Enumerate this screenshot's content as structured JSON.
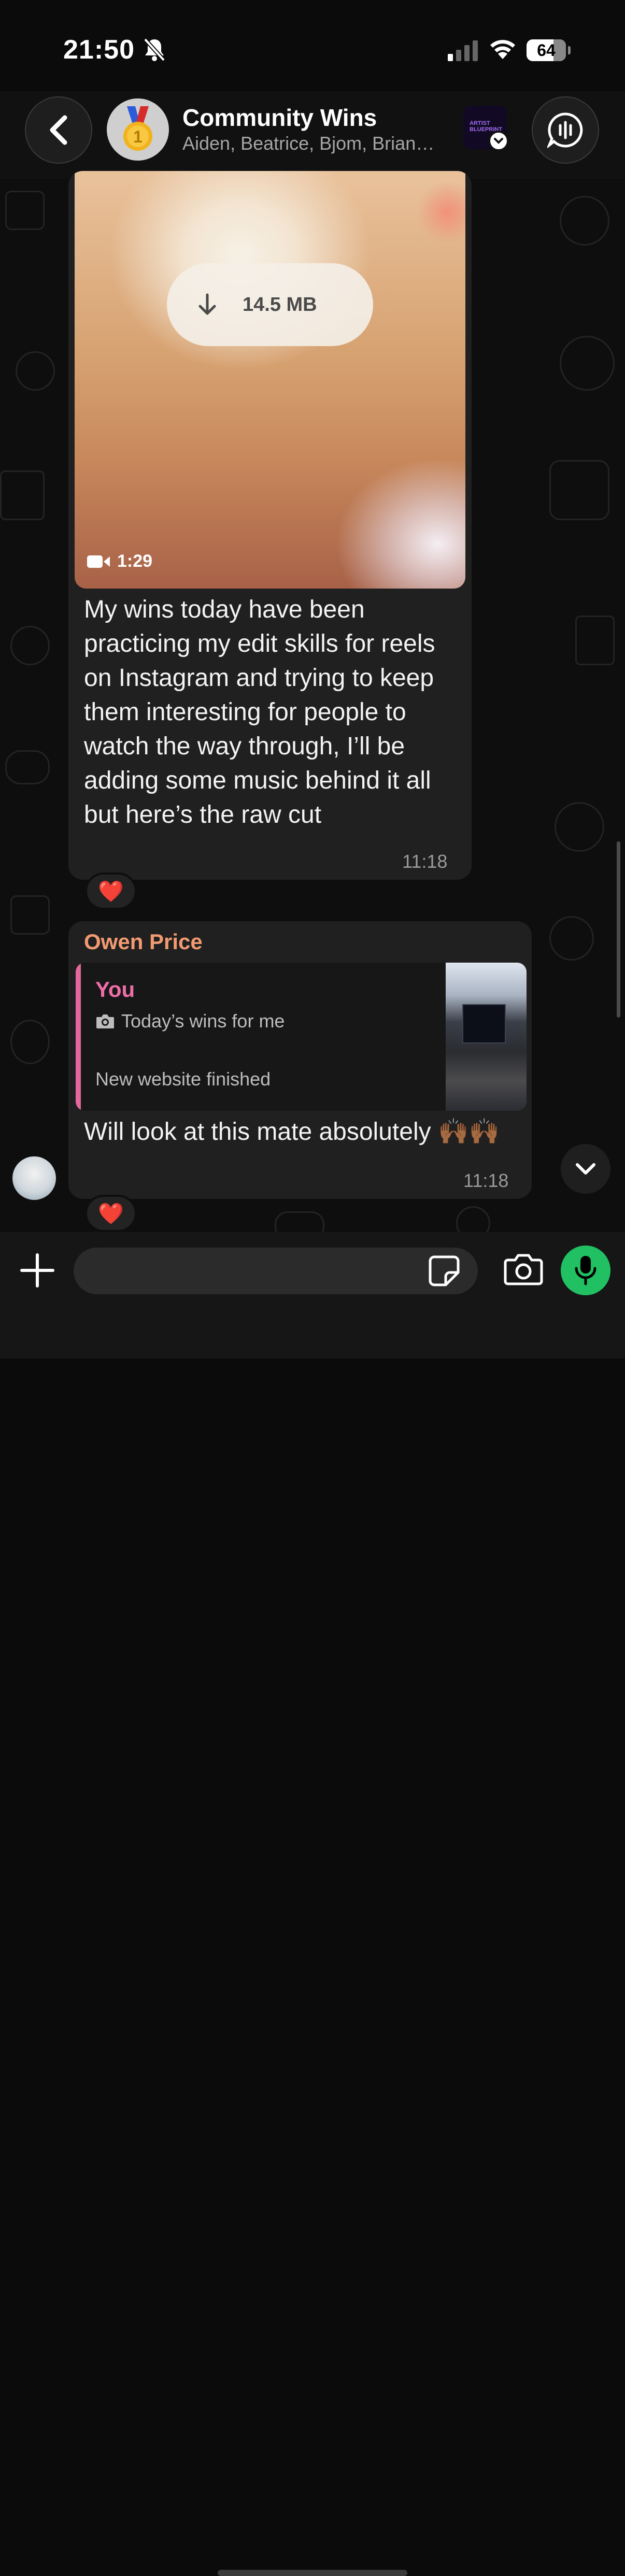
{
  "status_bar": {
    "time": "21:50",
    "battery": "64"
  },
  "header": {
    "title": "Community Wins",
    "members": "Aiden, Beatrice, Bjom, Brian…"
  },
  "messages": [
    {
      "video": {
        "size": "14.5 MB",
        "duration": "1:29"
      },
      "text": "My wins today have been practicing my edit skills for reels on Instagram and trying to keep them interesting for people to watch the way through, I’ll be adding some music behind it all but here’s the raw cut",
      "time": "11:18",
      "reaction": "❤️"
    },
    {
      "sender": "Owen Price",
      "sender_color": "#f29b72",
      "quote": {
        "author": "You",
        "line1": "Today’s wins for me",
        "line2": "New website finished"
      },
      "text": "Will look at this mate absolutely 🙌🏾🙌🏾",
      "time": "11:18",
      "reaction": "❤️"
    }
  ],
  "input": {
    "placeholder": ""
  },
  "colors": {
    "accent_green": "#21c063",
    "quote_bar": "#e6679b",
    "sender": "#f29b72"
  },
  "icons": [
    "back-chevron-icon",
    "medal-icon",
    "voice-chat-icon",
    "download-arrow-icon",
    "video-camera-icon",
    "camera-icon",
    "chevron-down-icon",
    "plus-icon",
    "sticker-icon",
    "mic-icon"
  ]
}
